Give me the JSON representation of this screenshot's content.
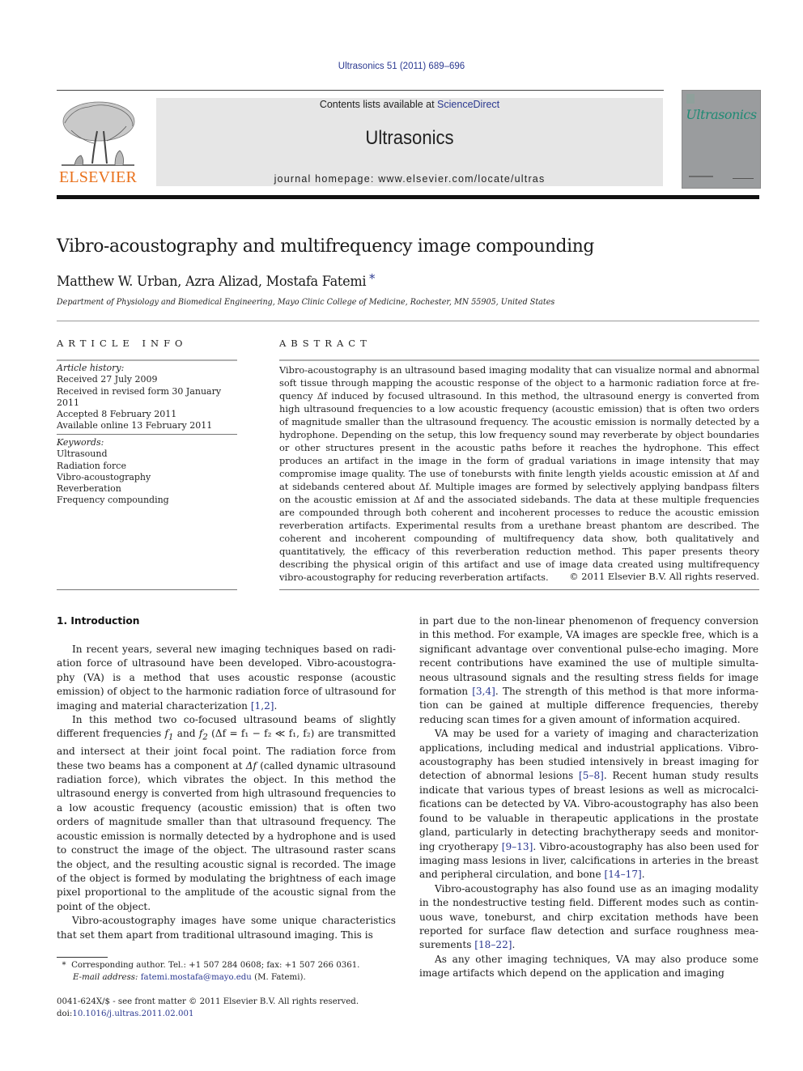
{
  "header": {
    "citation": "Ultrasonics 51 (2011) 689–696",
    "contents_prefix": "Contents lists available at ",
    "contents_link": "ScienceDirect",
    "journal_name": "Ultrasonics",
    "homepage_prefix": "journal homepage: ",
    "homepage_url": "www.elsevier.com/locate/ultras",
    "publisher_logo_text": "ELSEVIER",
    "cover_title": "Ultrasonics",
    "colors": {
      "elsevier_orange": "#e9711c",
      "link_blue": "#2b3990",
      "cover_teal": "#1f8a74",
      "masthead_gray": "#e6e6e6"
    }
  },
  "article": {
    "title": "Vibro-acoustography and multifrequency image compounding",
    "authors": "Matthew W. Urban, Azra Alizad, Mostafa Fatemi",
    "corresponding_mark": "*",
    "affiliation": "Department of Physiology and Biomedical Engineering, Mayo Clinic College of Medicine, Rochester, MN 55905, United States"
  },
  "article_info": {
    "caption": "ARTICLE INFO",
    "history_label": "Article history:",
    "history": [
      "Received 27 July 2009",
      "Received in revised form 30 January 2011",
      "Accepted 8 February 2011",
      "Available online 13 February 2011"
    ],
    "keywords_label": "Keywords:",
    "keywords": [
      "Ultrasound",
      "Radiation force",
      "Vibro-acoustography",
      "Reverberation",
      "Frequency compounding"
    ]
  },
  "abstract": {
    "caption": "ABSTRACT",
    "text": "Vibro-acoustography is an ultrasound based imaging modality that can visualize normal and abnormal soft tissue through mapping the acoustic response of the object to a harmonic radiation force at fre­quency Δf induced by focused ultrasound. In this method, the ultrasound energy is converted from high ultrasound frequencies to a low acoustic frequency (acoustic emission) that is often two orders of mag­nitude smaller than the ultrasound frequency. The acoustic emission is normally detected by a hydropho­ne. Depending on the setup, this low frequency sound may reverberate by object boundaries or other structures present in the acoustic paths before it reaches the hydrophone. This effect produces an artifact in the image in the form of gradual variations in image intensity that may compromise image quality. The use of tonebursts with finite length yields acoustic emission at Δf and at sidebands centered about Δf. Multiple images are formed by selectively applying bandpass filters on the acoustic emission at Δf and the associated sidebands. The data at these multiple frequencies are compounded through both coherent and incoherent processes to reduce the acoustic emission reverberation artifacts. Experimental results from a urethane breast phantom are described. The coherent and incoherent compounding of multifre­quency data show, both qualitatively and quantitatively, the efficacy of this reverberation reduction method. This paper presents theory describing the physical origin of this artifact and use of image data created using multifrequency vibro-acoustography for reducing reverberation artifacts.",
    "copyright": "© 2011 Elsevier B.V. All rights reserved."
  },
  "body": {
    "intro_heading": "1. Introduction",
    "left": {
      "p1_a": "In recent years, several new imaging techniques based on radi­ation force of ultrasound have been developed. Vibro-acoustogra­phy (VA) is a method that uses acoustic response (acoustic emission) of object to the harmonic radiation force of ultrasound for imaging and material characterization ",
      "p1_ref": "[1,2]",
      "p1_b": ".",
      "p2_a": "In this method two co-focused ultrasound beams of slightly different frequencies ",
      "p2_f1": "f",
      "p2_sub1": "1",
      "p2_and": " and ",
      "p2_f2": "f",
      "p2_sub2": "2",
      "p2_formula": " (Δf = f₁ − f₂ ≪ f₁, f₂)",
      "p2_b": " are transmitted and intersect at their joint focal point. The radiation force from these two beams has a component at ",
      "p2_df": "Δf",
      "p2_c": " (called dynamic ultra­sound radiation force), which vibrates the object. In this method the ultrasound energy is converted from high ultrasound frequen­cies to a low acoustic frequency (acoustic emission) that is often two orders of magnitude smaller than that ultrasound frequency. The acoustic emission is normally detected by a hydrophone and is used to construct the image of the object. The ultrasound raster scans the object, and the resulting acoustic signal is recorded. The image of the object is formed by modulating the brightness of each image pixel proportional to the amplitude of the acoustic signal from the point of the object.",
      "p3": "Vibro-acoustography images have some unique characteristics that set them apart from traditional ultrasound imaging. This is"
    },
    "right": {
      "p1_a": "in part due to the non-linear phenomenon of frequency conversion in this method. For example, VA images are speckle free, which is a significant advantage over conventional pulse-echo imaging. More recent contributions have examined the use of multiple simulta­neous ultrasound signals and the resulting stress fields for image formation ",
      "p1_ref": "[3,4]",
      "p1_b": ". The strength of this method is that more informa­tion can be gained at multiple difference frequencies, thereby reducing scan times for a given amount of information acquired.",
      "p2_a": "VA may be used for a variety of imaging and characterization applications, including medical and industrial applications. Vibro-acoustography has been studied intensively in breast imaging for detection of abnormal lesions ",
      "p2_ref1": "[5–8]",
      "p2_b": ". Recent human study results indicate that various types of breast lesions as well as microcalci­fications can be detected by VA. Vibro-acoustography has also been found to be valuable in therapeutic applications in the prostate gland, particularly in detecting brachytherapy seeds and monitor­ing cryotherapy ",
      "p2_ref2": "[9–13]",
      "p2_c": ". Vibro-acoustography has also been used for imaging mass lesions in liver, calcifications in arteries in the breast and peripheral circulation, and bone ",
      "p2_ref3": "[14–17]",
      "p2_d": ".",
      "p3_a": "Vibro-acoustography has also found use as an imaging modality in the nondestructive testing field. Different modes such as contin­uous wave, toneburst, and chirp excitation methods have been reported for surface flaw detection and surface roughness mea­surements ",
      "p3_ref": "[18–22]",
      "p3_b": ".",
      "p4": "As any other imaging techniques, VA may also produce some image artifacts which depend on the application and imaging"
    }
  },
  "footnote": {
    "mark": "*",
    "contact": "Corresponding author. Tel.: +1 507 284 0608; fax: +1 507 266 0361.",
    "email_label": "E-mail address:",
    "email": "fatemi.mostafa@mayo.edu",
    "email_suffix": " (M. Fatemi)."
  },
  "imprint": {
    "issn_line": "0041-624X/$ - see front matter © 2011 Elsevier B.V. All rights reserved.",
    "doi_prefix": "doi:",
    "doi": "10.1016/j.ultras.2011.02.001"
  }
}
